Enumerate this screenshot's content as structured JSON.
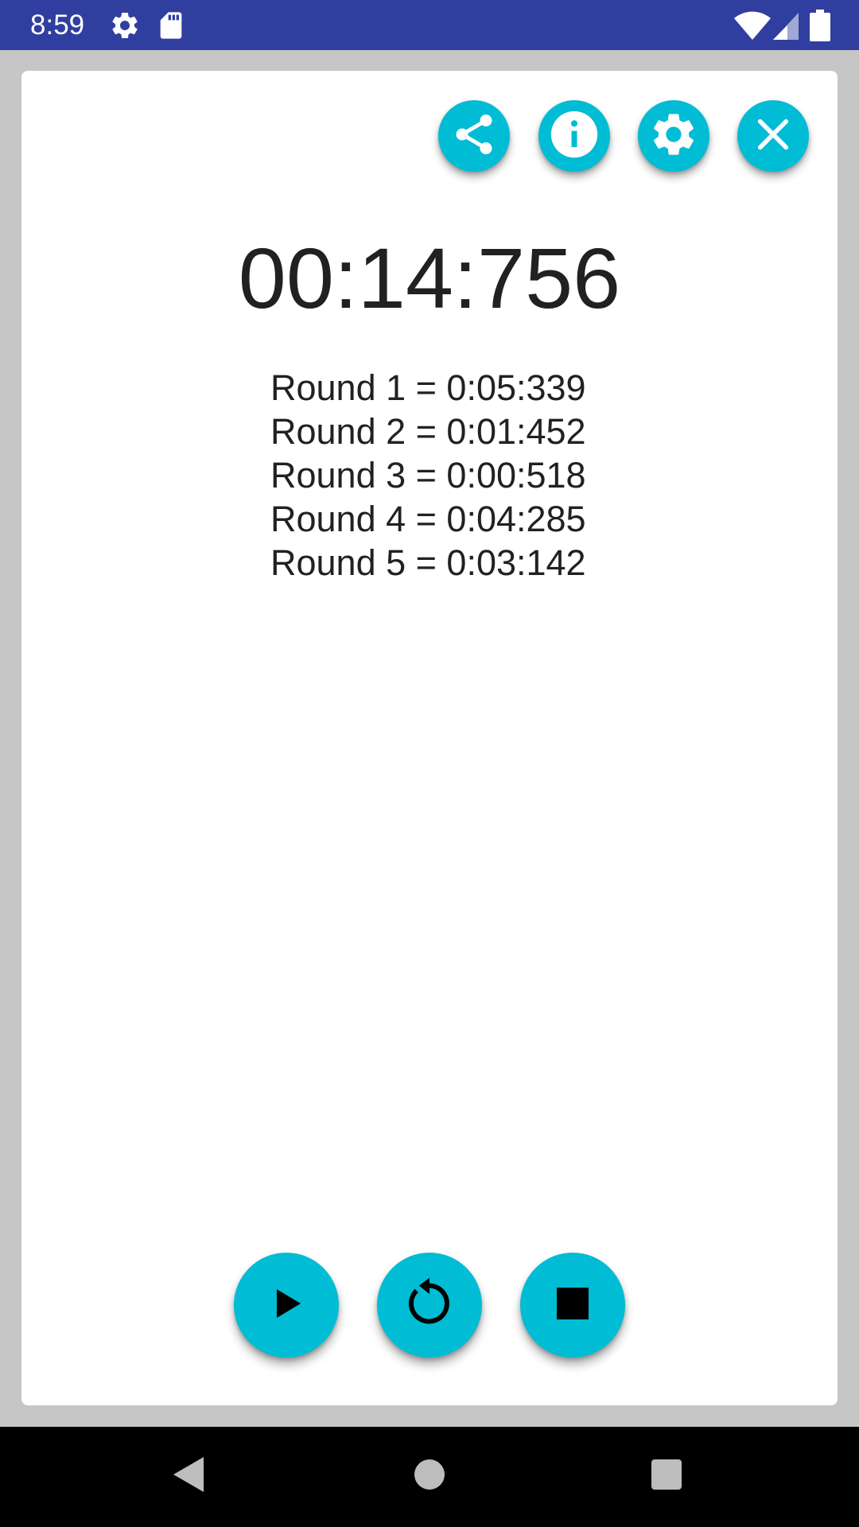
{
  "status_bar": {
    "time": "8:59",
    "icons": [
      "settings-icon",
      "sd-card-icon",
      "wifi-icon",
      "signal-icon",
      "battery-icon"
    ],
    "color": "#303f9f"
  },
  "toolbar": {
    "buttons": [
      "share-icon",
      "info-icon",
      "settings-icon",
      "close-icon"
    ]
  },
  "stopwatch": {
    "time": "00:14:756",
    "rounds": [
      "Round 1 = 0:05:339",
      "Round 2 = 0:01:452",
      "Round 3 = 0:00:518",
      "Round 4 = 0:04:285",
      "Round 5 = 0:03:142"
    ]
  },
  "controls": {
    "buttons": [
      "play-icon",
      "reset-icon",
      "stop-icon"
    ]
  },
  "nav_bar": {
    "buttons": [
      "back-icon",
      "home-icon",
      "recents-icon"
    ]
  },
  "colors": {
    "accent": "#00bcd4",
    "background": "#c6c6c6",
    "card": "#ffffff",
    "text": "#212121"
  }
}
